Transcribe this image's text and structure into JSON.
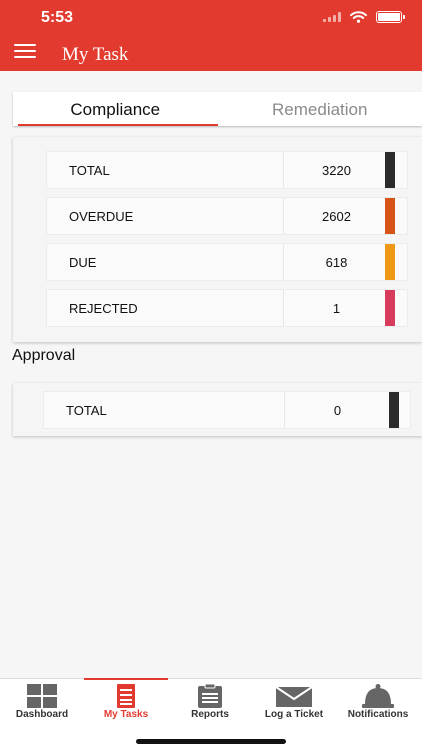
{
  "status_bar": {
    "time": "5:53"
  },
  "header": {
    "title": "My Task"
  },
  "tabs": [
    {
      "label": "Compliance",
      "active": true
    },
    {
      "label": "Remediation",
      "active": false
    }
  ],
  "compliance": {
    "rows": [
      {
        "label": "TOTAL",
        "value": "3220",
        "color": "#2b2b2b"
      },
      {
        "label": "OVERDUE",
        "value": "2602",
        "color": "#d65418"
      },
      {
        "label": "DUE",
        "value": "618",
        "color": "#ee9816"
      },
      {
        "label": "REJECTED",
        "value": "1",
        "color": "#d83c5c"
      }
    ]
  },
  "approval": {
    "title": "Approval",
    "rows": [
      {
        "label": "TOTAL",
        "value": "0",
        "color": "#2b2b2b"
      }
    ]
  },
  "tabbar": {
    "items": [
      {
        "label": "Dashboard",
        "icon": "dashboard-icon",
        "active": false
      },
      {
        "label": "My Tasks",
        "icon": "my-tasks-icon",
        "active": true
      },
      {
        "label": "Reports",
        "icon": "reports-icon",
        "active": false
      },
      {
        "label": "Log a Ticket",
        "icon": "log-ticket-icon",
        "active": false
      },
      {
        "label": "Notifications",
        "icon": "notifications-icon",
        "active": false
      }
    ]
  },
  "colors": {
    "brand": "#e23a2e"
  }
}
